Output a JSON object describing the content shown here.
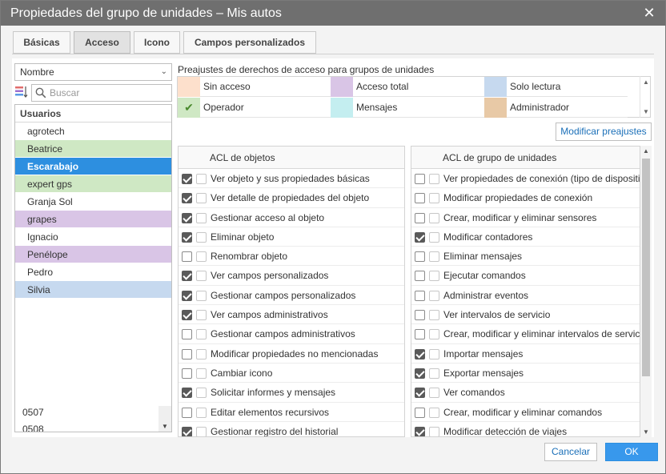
{
  "window": {
    "title": "Propiedades del grupo de unidades – Mis autos"
  },
  "tabs": [
    {
      "label": "Básicas",
      "active": false
    },
    {
      "label": "Acceso",
      "active": true
    },
    {
      "label": "Icono",
      "active": false
    },
    {
      "label": "Campos personalizados",
      "active": false
    }
  ],
  "users": {
    "filter_value": "Nombre",
    "search_placeholder": "Buscar",
    "header": "Usuarios",
    "items": [
      {
        "name": "agrotech",
        "color": "#ffffff",
        "selected": false
      },
      {
        "name": "Beatrice",
        "color": "#cfe8c4",
        "selected": false
      },
      {
        "name": "Escarabajo",
        "color": "#2d8fe0",
        "selected": true
      },
      {
        "name": "expert gps",
        "color": "#cfe8c4",
        "selected": false
      },
      {
        "name": "Granja Sol",
        "color": "#ffffff",
        "selected": false
      },
      {
        "name": "grapes",
        "color": "#d9c5e6",
        "selected": false
      },
      {
        "name": "Ignacio",
        "color": "#ffffff",
        "selected": false
      },
      {
        "name": "Penélope",
        "color": "#d9c5e6",
        "selected": false
      },
      {
        "name": "Pedro",
        "color": "#ffffff",
        "selected": false
      },
      {
        "name": "Silvia",
        "color": "#c6d9ef",
        "selected": false
      }
    ],
    "extra_items": [
      "0507",
      "0508"
    ]
  },
  "presets": {
    "label": "Preajustes de derechos de acceso para grupos de unidades",
    "items": [
      {
        "label": "Sin acceso",
        "color": "#fde0cc",
        "checked": false
      },
      {
        "label": "Acceso total",
        "color": "#d9c5e6",
        "checked": false
      },
      {
        "label": "Solo lectura",
        "color": "#c6d9ef",
        "checked": false
      },
      {
        "label": "Operador",
        "color": "#cfe8c4",
        "checked": true
      },
      {
        "label": "Mensajes",
        "color": "#c4eef0",
        "checked": false
      },
      {
        "label": "Administrador",
        "color": "#e8c9a6",
        "checked": false
      }
    ],
    "modify_button": "Modificar preajustes"
  },
  "acl_objects": {
    "header": "ACL de objetos",
    "rows": [
      {
        "label": "Ver objeto y sus propiedades básicas",
        "checked": true
      },
      {
        "label": "Ver detalle de propiedades del objeto",
        "checked": true
      },
      {
        "label": "Gestionar acceso al objeto",
        "checked": true
      },
      {
        "label": "Eliminar objeto",
        "checked": true
      },
      {
        "label": "Renombrar objeto",
        "checked": false
      },
      {
        "label": "Ver campos personalizados",
        "checked": true
      },
      {
        "label": "Gestionar campos personalizados",
        "checked": true
      },
      {
        "label": "Ver campos administrativos",
        "checked": true
      },
      {
        "label": "Gestionar campos administrativos",
        "checked": false
      },
      {
        "label": "Modificar propiedades no mencionadas",
        "checked": false
      },
      {
        "label": "Cambiar icono",
        "checked": false
      },
      {
        "label": "Solicitar informes y mensajes",
        "checked": true
      },
      {
        "label": "Editar elementos recursivos",
        "checked": false
      },
      {
        "label": "Gestionar registro del historial",
        "checked": true
      }
    ]
  },
  "acl_units": {
    "header": "ACL de grupo de unidades",
    "rows": [
      {
        "label": "Ver propiedades de conexión (tipo de dispositivo...",
        "checked": false
      },
      {
        "label": "Modificar propiedades de conexión",
        "checked": false
      },
      {
        "label": "Crear, modificar y eliminar sensores",
        "checked": false
      },
      {
        "label": "Modificar contadores",
        "checked": true
      },
      {
        "label": "Eliminar mensajes",
        "checked": false
      },
      {
        "label": "Ejecutar comandos",
        "checked": false
      },
      {
        "label": "Administrar eventos",
        "checked": false
      },
      {
        "label": "Ver intervalos de servicio",
        "checked": false
      },
      {
        "label": "Crear, modificar y eliminar intervalos de servicio",
        "checked": false
      },
      {
        "label": "Importar mensajes",
        "checked": true
      },
      {
        "label": "Exportar mensajes",
        "checked": true
      },
      {
        "label": "Ver comandos",
        "checked": true
      },
      {
        "label": "Crear, modificar y eliminar comandos",
        "checked": false
      },
      {
        "label": "Modificar detección de viajes",
        "checked": true
      }
    ]
  },
  "footer": {
    "cancel": "Cancelar",
    "ok": "OK"
  },
  "colors": {
    "accent": "#3898ec",
    "titlebar": "#6f6f6f",
    "link": "#1a6fb8"
  }
}
